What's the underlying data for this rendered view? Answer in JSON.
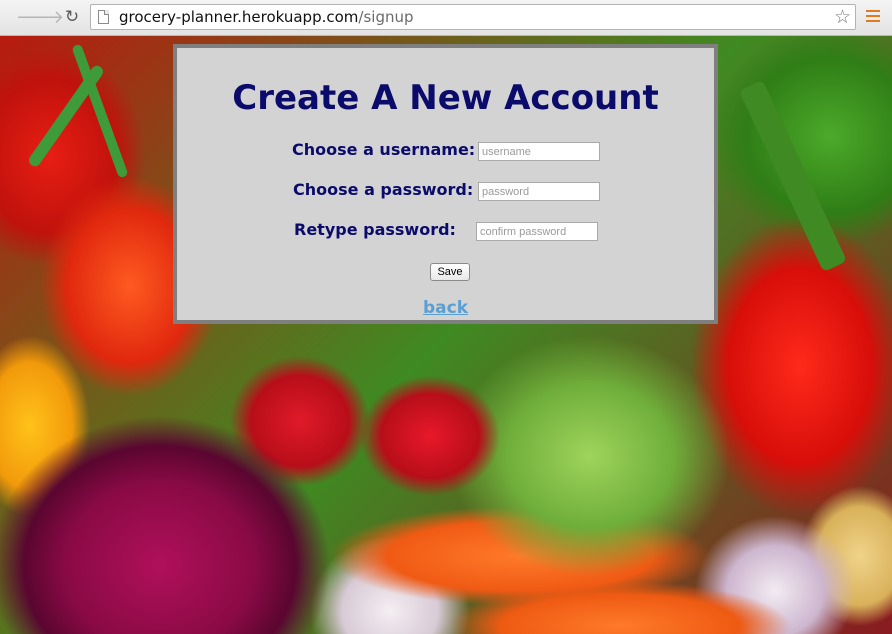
{
  "browser": {
    "url_host": "grocery-planner.herokuapp.com",
    "url_path": "/signup",
    "icons": [
      "back-arrow-icon",
      "forward-arrow-icon",
      "reload-icon",
      "page-icon",
      "bookmark-star-icon",
      "menu-icon"
    ],
    "accent_menu_color": "#e07b20"
  },
  "form": {
    "title": "Create A New Account",
    "username_label": "Choose a username:",
    "username_placeholder": "username",
    "password_label": "Choose a password:",
    "password_placeholder": "password",
    "confirm_label": "Retype password:",
    "confirm_placeholder": "confirm password",
    "save_label": "Save",
    "back_label": "back"
  },
  "colors": {
    "title_color": "#0b0b6b",
    "panel_bg": "#d3d3d3",
    "link_color": "#5a9fd4"
  }
}
